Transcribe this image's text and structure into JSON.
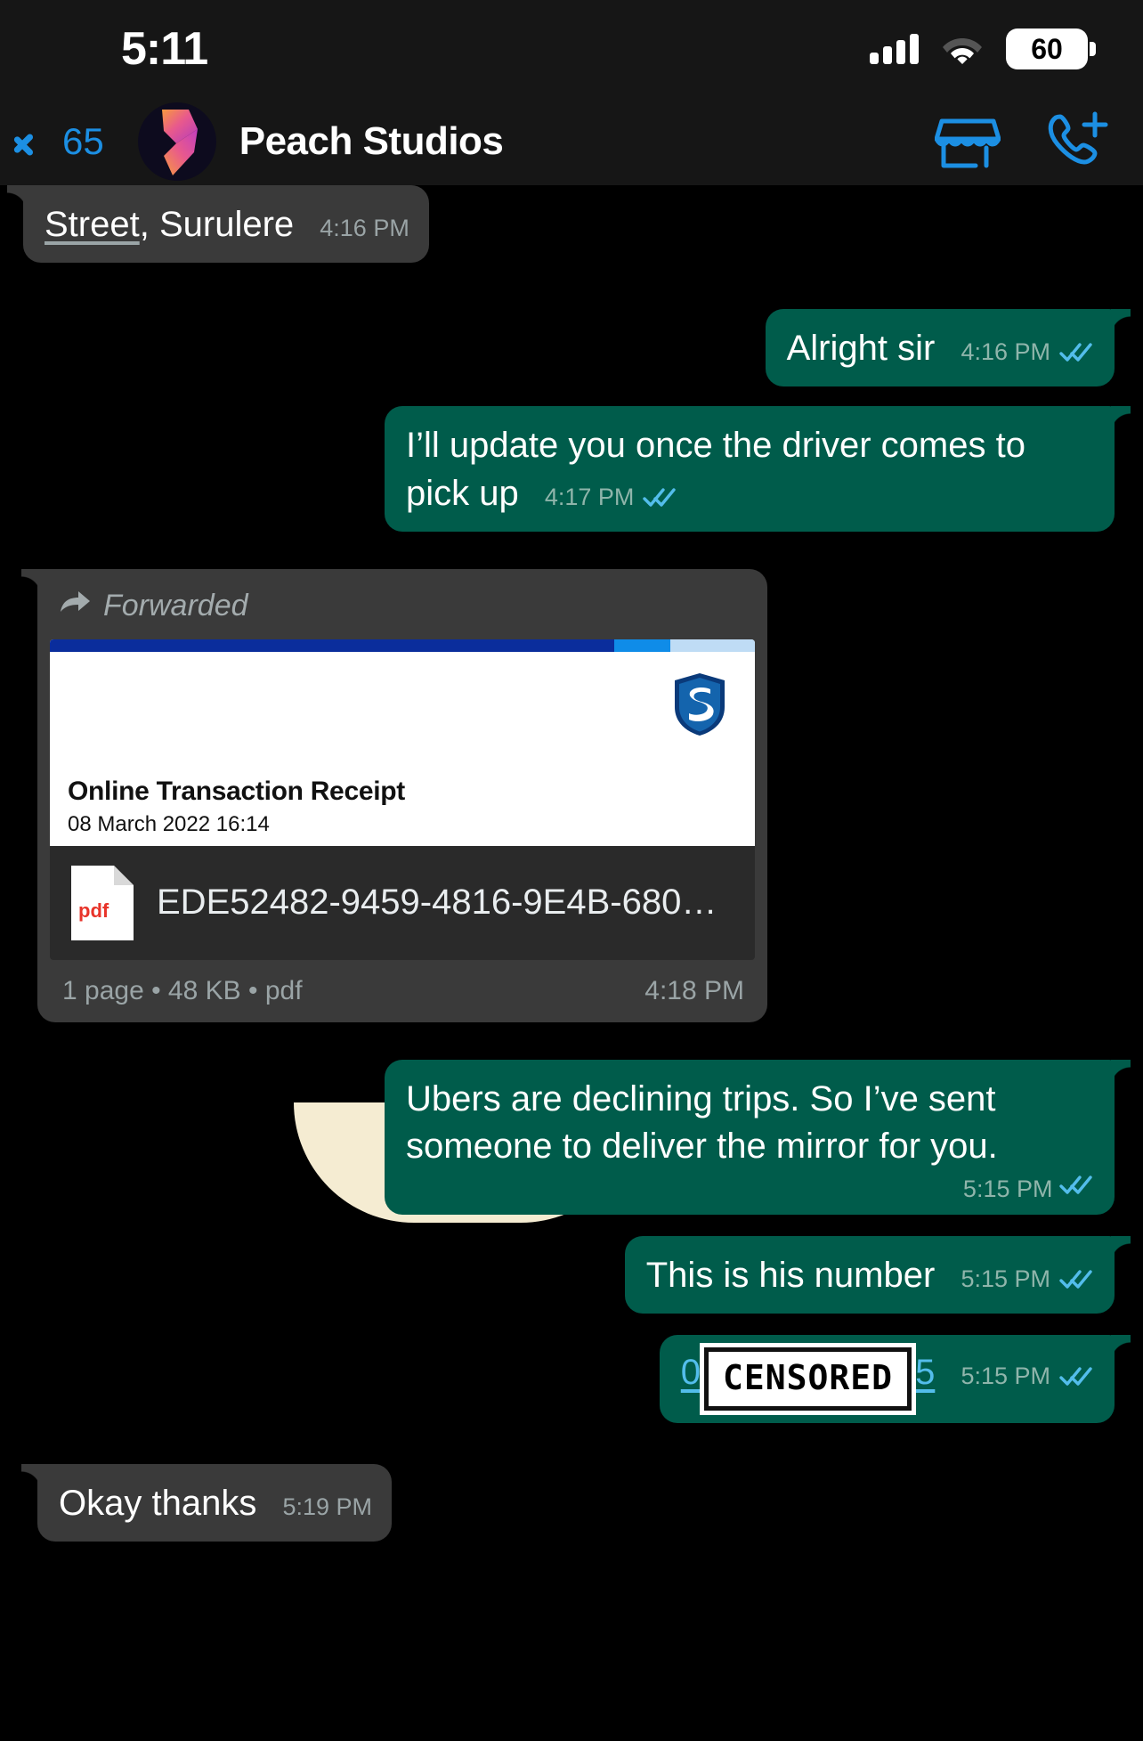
{
  "status_bar": {
    "time": "5:11",
    "battery_percent": "60",
    "signal_icon": "cellular-bars-icon",
    "wifi_icon": "wifi-icon",
    "battery_icon": "battery-icon"
  },
  "nav": {
    "back_icon": "chevron-left-icon",
    "back_count": "65",
    "avatar_name": "avatar",
    "title": "Peach Studios",
    "storefront_icon": "storefront-icon",
    "add_call_icon": "phone-plus-icon"
  },
  "messages": [
    {
      "id": "msg-street",
      "dir": "in",
      "kind": "text",
      "link_text": "Street",
      "text": ", Surulere",
      "time": "4:16 PM"
    },
    {
      "id": "msg-alright",
      "dir": "out",
      "kind": "text",
      "text": "Alright sir",
      "time": "4:16 PM",
      "status": "read"
    },
    {
      "id": "msg-update",
      "dir": "out",
      "kind": "text",
      "text": "I’ll update you once the driver comes to pick up",
      "time": "4:17 PM",
      "status": "read"
    },
    {
      "id": "msg-document",
      "dir": "in",
      "kind": "document",
      "forwarded_label": "Forwarded",
      "forward_icon": "forward-arrow-icon",
      "preview": {
        "bank_logo": "standard-bank-shield-icon",
        "title": "Online Transaction Receipt",
        "date": "08 March 2022 16:14"
      },
      "file_icon": "pdf-file-icon",
      "file_icon_label": "pdf",
      "filename": "EDE52482-9459-4816-9E4B-680…",
      "pages": "1 page",
      "size": "48 KB",
      "filetype": "pdf",
      "meta_line": "1 page • 48 KB • pdf",
      "time": "4:18 PM"
    },
    {
      "id": "msg-ubers",
      "dir": "out",
      "kind": "text",
      "text": "Ubers are declining trips. So I’ve sent someone to deliver the mirror for you.",
      "time": "5:15 PM",
      "status": "read"
    },
    {
      "id": "msg-hisnumber",
      "dir": "out",
      "kind": "text",
      "text": "This is his number",
      "time": "5:15 PM",
      "status": "read"
    },
    {
      "id": "msg-phone",
      "dir": "out",
      "kind": "phone",
      "prefix": "0",
      "censored_label": "CENSORED",
      "suffix": "5",
      "time": "5:15 PM",
      "status": "read"
    },
    {
      "id": "msg-okay",
      "dir": "in",
      "kind": "text",
      "text": "Okay thanks",
      "time": "5:19 PM"
    }
  ],
  "colors": {
    "outgoing_bubble": "#005c4b",
    "incoming_bubble": "#3a3a3a",
    "accent_blue": "#1c8fe3",
    "tick_blue": "#53bdeb",
    "chat_background": "#000000",
    "header_background": "#161616",
    "bank_blue": "#0a2d9c",
    "pdf_red": "#e8342a"
  }
}
